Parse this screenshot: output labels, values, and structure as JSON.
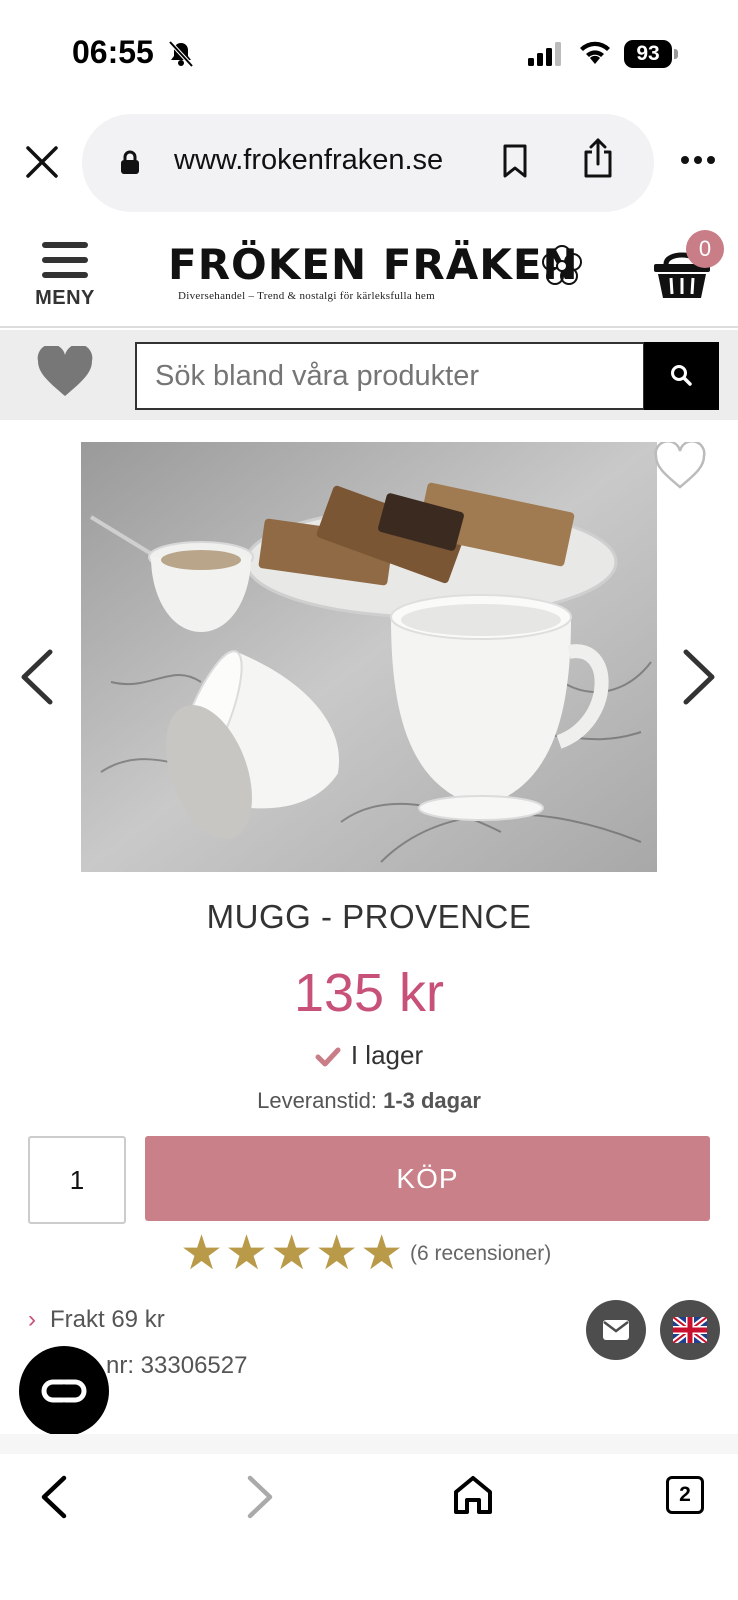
{
  "status_bar": {
    "time": "06:55",
    "battery": "93"
  },
  "browser": {
    "url": "www.frokenfraken.se",
    "open_tabs": "2"
  },
  "site": {
    "menu_label": "MENY",
    "logo_text": "FRÖKEN FRÄKEN",
    "tagline": "Diversehandel – Trend & nostalgi för kärleksfulla hem",
    "cart_count": "0"
  },
  "search": {
    "placeholder": "Sök bland våra produkter"
  },
  "product": {
    "title": "MUGG - PROVENCE",
    "price": "135 kr",
    "stock": "I lager",
    "delivery_label": "Leveranstid:",
    "delivery_value": "1-3 dagar",
    "quantity": "1",
    "buy_label": "KÖP",
    "rating": 5,
    "reviews": "(6 recensioner)",
    "freight": "Frakt 69 kr",
    "article_number": "nr: 33306527"
  },
  "colors": {
    "accent": "#c8517a",
    "buy_button": "#c98089",
    "stars": "#b89a49"
  }
}
